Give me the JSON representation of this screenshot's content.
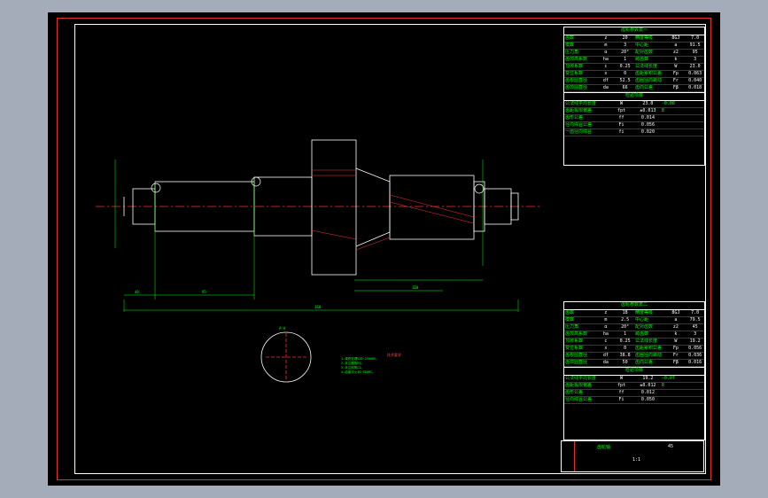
{
  "drawing": {
    "table_top": {
      "title": "齿轮参数表一",
      "rows": [
        [
          "齿数",
          "z",
          "20",
          "精度等级",
          "8GJ",
          "7.0"
        ],
        [
          "模数",
          "m",
          "3",
          "中心距",
          "a",
          "91.5"
        ],
        [
          "压力角",
          "α",
          "20°",
          "配对齿数",
          "z2",
          "95"
        ],
        [
          "齿顶高系数",
          "ha",
          "1",
          "跨齿数",
          "k",
          "3"
        ],
        [
          "顶隙系数",
          "c",
          "0.25",
          "公法线长度",
          "W",
          "23.0"
        ],
        [
          "变位系数",
          "x",
          "0",
          "齿距累积公差",
          "Fp",
          "0.063"
        ],
        [
          "齿根圆直径",
          "df",
          "52.5",
          "齿圈径向跳动",
          "Fr",
          "0.040"
        ],
        [
          "齿顶圆直径",
          "da",
          "66",
          "齿向公差",
          "Fβ",
          "0.018"
        ]
      ],
      "sub_title": "检验项目",
      "rows2": [
        [
          "公法线平均长度",
          "W",
          "23.0",
          "-0.08"
        ],
        [
          "齿距极限偏差",
          "fpt",
          "±0.013",
          "8"
        ],
        [
          "齿形公差",
          "ff",
          "0.014",
          ""
        ],
        [
          "径向综合公差",
          "Fi",
          "0.056",
          ""
        ],
        [
          "一齿径向综合",
          "fi",
          "0.020",
          ""
        ]
      ]
    },
    "table_bottom": {
      "title": "齿轮参数表二",
      "rows": [
        [
          "齿数",
          "z",
          "18",
          "精度等级",
          "8GJ",
          "7.0"
        ],
        [
          "模数",
          "m",
          "2.5",
          "中心距",
          "a",
          "79.5"
        ],
        [
          "压力角",
          "α",
          "20°",
          "配对齿数",
          "z2",
          "45"
        ],
        [
          "齿顶高系数",
          "ha",
          "1",
          "跨齿数",
          "k",
          "3"
        ],
        [
          "顶隙系数",
          "c",
          "0.25",
          "公法线长度",
          "W",
          "19.2"
        ],
        [
          "变位系数",
          "x",
          "0",
          "齿距累积公差",
          "Fp",
          "0.056"
        ],
        [
          "齿根圆直径",
          "df",
          "38.8",
          "齿圈径向跳动",
          "Fr",
          "0.036"
        ],
        [
          "齿顶圆直径",
          "da",
          "50",
          "齿向公差",
          "Fβ",
          "0.016"
        ]
      ],
      "sub_title": "检验项目",
      "rows2": [
        [
          "公法线平均长度",
          "W",
          "19.2",
          "-0.07"
        ],
        [
          "齿距极限偏差",
          "fpt",
          "±0.012",
          "8"
        ],
        [
          "齿形公差",
          "ff",
          "0.012",
          ""
        ],
        [
          "径向综合公差",
          "Fi",
          "0.050",
          ""
        ]
      ]
    },
    "notes": {
      "title": "技术要求",
      "lines": [
        "1.调质处理220~250HBS。",
        "2.未注圆角R1。",
        "3.未注倒角C1。",
        "4.齿面淬火45~50HRC。"
      ]
    },
    "title_block": {
      "name": "齿轮轴",
      "scale": "1:1",
      "material": "45"
    },
    "dimensions": {
      "overall": "360",
      "seg1": "48",
      "seg2": "95",
      "seg3": "110",
      "section_label": "A-A"
    },
    "colors": {
      "geometry": "#ffffff",
      "dimension": "#00ff00",
      "centerline": "#ff3030",
      "annotation": "#00ffff"
    }
  }
}
